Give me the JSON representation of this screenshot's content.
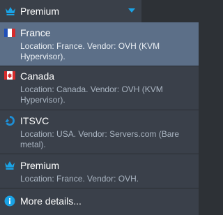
{
  "header": {
    "selected_label": "Premium"
  },
  "items": [
    {
      "title": "France",
      "desc": "Location: France. Vendor: OVH (KVM Hypervisor).",
      "icon": "france-flag-icon"
    },
    {
      "title": "Canada",
      "desc": "Location: Canada. Vendor: OVH (KVM Hypervisor).",
      "icon": "canada-flag-icon"
    },
    {
      "title": "ITSVC",
      "desc": "Location: USA. Vendor: Servers.com (Bare metal).",
      "icon": "itsvc-logo-icon"
    },
    {
      "title": "Premium",
      "desc": "Location: France. Vendor: OVH.",
      "icon": "crown-icon"
    }
  ],
  "more_details": "More details...",
  "colors": {
    "accent": "#1aa3e6",
    "selected_bg": "#5c6f88",
    "menu_bg": "#3a404a"
  }
}
